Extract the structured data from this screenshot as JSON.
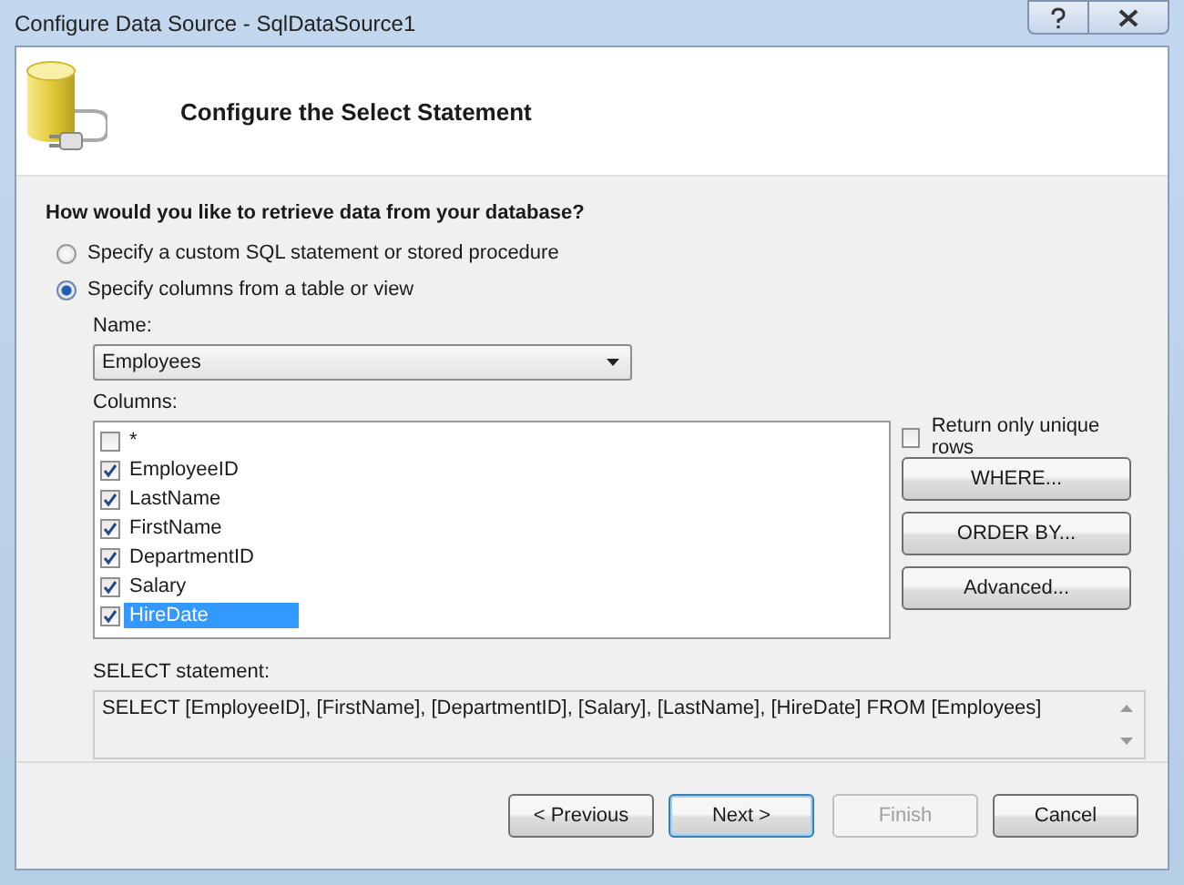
{
  "window": {
    "title": "Configure Data Source - SqlDataSource1"
  },
  "header": {
    "title": "Configure the Select Statement"
  },
  "question": "How would you like to retrieve data from your database?",
  "options": [
    {
      "label": "Specify a custom SQL statement or stored procedure",
      "selected": false
    },
    {
      "label": "Specify columns from a table or view",
      "selected": true
    }
  ],
  "name": {
    "label": "Name:",
    "value": "Employees"
  },
  "columns": {
    "label": "Columns:",
    "items": [
      {
        "label": "*",
        "checked": false,
        "selected": false
      },
      {
        "label": "EmployeeID",
        "checked": true,
        "selected": false
      },
      {
        "label": "LastName",
        "checked": true,
        "selected": false
      },
      {
        "label": "FirstName",
        "checked": true,
        "selected": false
      },
      {
        "label": "DepartmentID",
        "checked": true,
        "selected": false
      },
      {
        "label": "Salary",
        "checked": true,
        "selected": false
      },
      {
        "label": "HireDate",
        "checked": true,
        "selected": true
      }
    ]
  },
  "unique_rows": {
    "label": "Return only unique rows",
    "checked": false
  },
  "side_buttons": [
    "WHERE...",
    "ORDER BY...",
    "Advanced..."
  ],
  "select_statement": {
    "label": "SELECT statement:",
    "value": "SELECT [EmployeeID], [FirstName], [DepartmentID], [Salary], [LastName], [HireDate] FROM [Employees]"
  },
  "footer_buttons": [
    {
      "label": "< Previous",
      "disabled": false,
      "default": false
    },
    {
      "label": "Next >",
      "disabled": false,
      "default": true
    },
    {
      "label": "Finish",
      "disabled": true,
      "default": false
    },
    {
      "label": "Cancel",
      "disabled": false,
      "default": false
    }
  ]
}
